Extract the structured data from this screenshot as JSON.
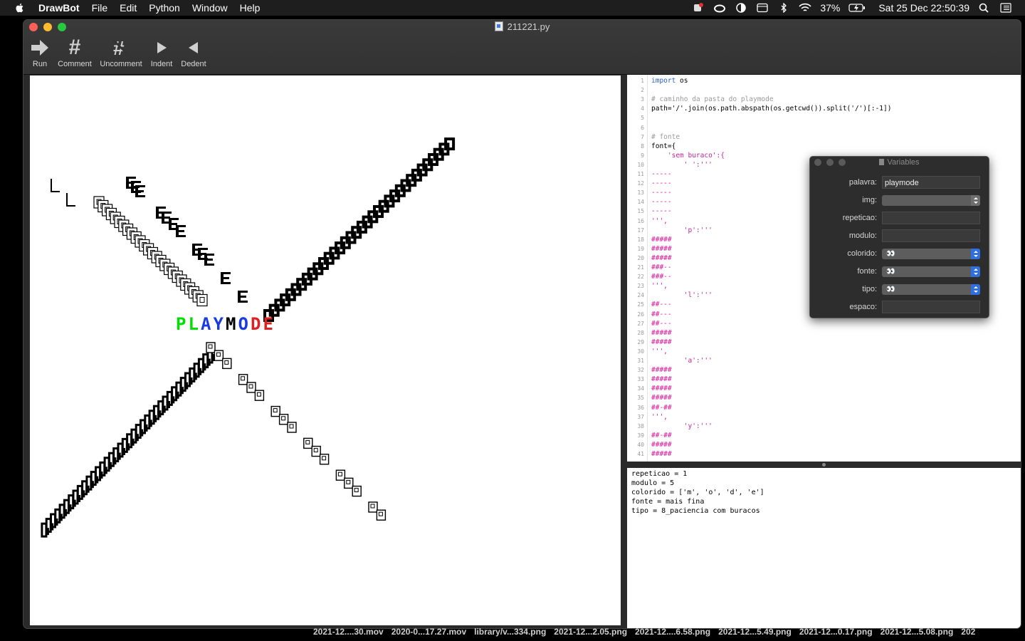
{
  "menubar": {
    "app_name": "DrawBot",
    "items": [
      "File",
      "Edit",
      "Python",
      "Window",
      "Help"
    ],
    "battery": "37%",
    "clock": "Sat 25 Dec  22:50:39"
  },
  "window": {
    "title": "211221.py",
    "toolbar": [
      {
        "label": "Run",
        "icon": "run-arrow-icon"
      },
      {
        "label": "Comment",
        "icon": "hash-icon"
      },
      {
        "label": "Uncomment",
        "icon": "uncomment-hash-icon"
      },
      {
        "label": "Indent",
        "icon": "indent-triangle-icon"
      },
      {
        "label": "Dedent",
        "icon": "dedent-triangle-icon"
      }
    ]
  },
  "canvas": {
    "word": "PLAYMODE",
    "word_colors": [
      "#00e000",
      "#00e000",
      "#1a3be0",
      "#1a3be0",
      "#000000",
      "#1a3be0",
      "#e02020",
      "#e02020"
    ]
  },
  "editor": {
    "lines": [
      {
        "n": "1",
        "t": "import os",
        "c": "kw1"
      },
      {
        "n": "2",
        "t": "",
        "c": ""
      },
      {
        "n": "3",
        "t": "# caminho da pasta do playmode",
        "c": "cm"
      },
      {
        "n": "4",
        "t": "path='/'.join(os.path.abspath(os.getcwd()).split('/')[:-1])",
        "c": ""
      },
      {
        "n": "5",
        "t": "",
        "c": ""
      },
      {
        "n": "6",
        "t": "",
        "c": ""
      },
      {
        "n": "7",
        "t": "# fonte",
        "c": "cm"
      },
      {
        "n": "8",
        "t": "font={",
        "c": ""
      },
      {
        "n": "9",
        "t": "    'sem buraco':{",
        "c": "st"
      },
      {
        "n": "10",
        "t": "        ' ':'''",
        "c": "st"
      },
      {
        "n": "11",
        "t": "-----",
        "c": "pk"
      },
      {
        "n": "12",
        "t": "-----",
        "c": "pk"
      },
      {
        "n": "13",
        "t": "-----",
        "c": "pk"
      },
      {
        "n": "14",
        "t": "-----",
        "c": "pk"
      },
      {
        "n": "15",
        "t": "-----",
        "c": "pk"
      },
      {
        "n": "16",
        "t": "''',",
        "c": "pk"
      },
      {
        "n": "17",
        "t": "        'p':'''",
        "c": "st"
      },
      {
        "n": "18",
        "t": "#####",
        "c": "pk"
      },
      {
        "n": "19",
        "t": "#####",
        "c": "pk"
      },
      {
        "n": "20",
        "t": "#####",
        "c": "pk"
      },
      {
        "n": "21",
        "t": "###--",
        "c": "pk"
      },
      {
        "n": "22",
        "t": "###--",
        "c": "pk"
      },
      {
        "n": "23",
        "t": "''',",
        "c": "pk"
      },
      {
        "n": "24",
        "t": "        'l':'''",
        "c": "st"
      },
      {
        "n": "25",
        "t": "##---",
        "c": "pk"
      },
      {
        "n": "26",
        "t": "##---",
        "c": "pk"
      },
      {
        "n": "27",
        "t": "##---",
        "c": "pk"
      },
      {
        "n": "28",
        "t": "#####",
        "c": "pk"
      },
      {
        "n": "29",
        "t": "#####",
        "c": "pk"
      },
      {
        "n": "30",
        "t": "''',",
        "c": "pk"
      },
      {
        "n": "31",
        "t": "        'a':'''",
        "c": "st"
      },
      {
        "n": "32",
        "t": "#####",
        "c": "pk"
      },
      {
        "n": "33",
        "t": "#####",
        "c": "pk"
      },
      {
        "n": "34",
        "t": "#####",
        "c": "pk"
      },
      {
        "n": "35",
        "t": "#####",
        "c": "pk"
      },
      {
        "n": "36",
        "t": "##-##",
        "c": "pk"
      },
      {
        "n": "37",
        "t": "''',",
        "c": "pk"
      },
      {
        "n": "38",
        "t": "        'y':'''",
        "c": "st"
      },
      {
        "n": "39",
        "t": "##-##",
        "c": "pk"
      },
      {
        "n": "40",
        "t": "#####",
        "c": "pk"
      },
      {
        "n": "41",
        "t": "#####",
        "c": "pk"
      }
    ]
  },
  "output": {
    "lines": [
      "repeticao = 1",
      "modulo = 5",
      "colorido = ['m', 'o', 'd', 'e']",
      "fonte = mais fina",
      "tipo = 8_paciencia com buracos"
    ]
  },
  "variables": {
    "title": "Variables",
    "rows": [
      {
        "label": "palavra:",
        "kind": "text",
        "value": "playmode"
      },
      {
        "label": "img:",
        "kind": "popup-grey",
        "value": ""
      },
      {
        "label": "repeticao:",
        "kind": "text",
        "value": ""
      },
      {
        "label": "modulo:",
        "kind": "text",
        "value": ""
      },
      {
        "label": "colorido:",
        "kind": "popup",
        "value": "👀"
      },
      {
        "label": "fonte:",
        "kind": "popup",
        "value": "👀"
      },
      {
        "label": "tipo:",
        "kind": "popup",
        "value": "👀"
      },
      {
        "label": "espaco:",
        "kind": "text",
        "value": ""
      }
    ]
  },
  "desktop_files": [
    "2021-12....30.mov",
    "2020-0...17.27.mov",
    "library/v...334.png",
    "2021-12...2.05.png",
    "2021-12....6.58.png",
    "2021-12...5.49.png",
    "2021-12...0.17.png",
    "2021-12...5.08.png",
    "202"
  ]
}
